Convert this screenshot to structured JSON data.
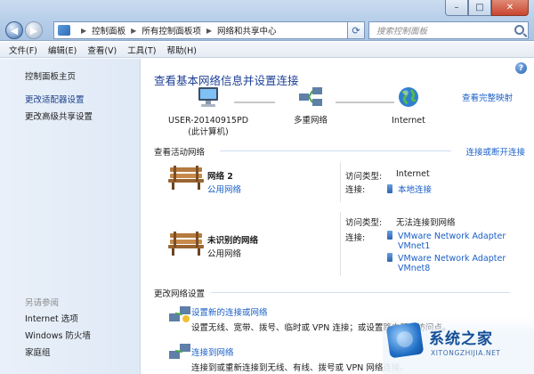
{
  "address": {
    "crumbs": [
      "控制面板",
      "所有控制面板项",
      "网络和共享中心"
    ],
    "search_placeholder": "搜索控制面板"
  },
  "menu": [
    "文件(F)",
    "编辑(E)",
    "查看(V)",
    "工具(T)",
    "帮助(H)"
  ],
  "sidebar": {
    "home": "控制面板主页",
    "links": [
      "更改适配器设置",
      "更改高级共享设置"
    ],
    "see_also_title": "另请参阅",
    "see_also": [
      "Internet 选项",
      "Windows 防火墙",
      "家庭组"
    ]
  },
  "main": {
    "heading": "查看基本网络信息并设置连接",
    "map_link": "查看完整映射",
    "nodes": [
      {
        "label": "USER-20140915PD",
        "sublabel": "(此计算机)"
      },
      {
        "label": "多重网络",
        "sublabel": ""
      },
      {
        "label": "Internet",
        "sublabel": ""
      }
    ],
    "active_title": "查看活动网络",
    "active_link": "连接或断开连接",
    "networks": [
      {
        "name": "网络  2",
        "category": "公用网络",
        "category_is_link": true,
        "access_label": "访问类型:",
        "access_value": "Internet",
        "conn_label": "连接:",
        "connections": [
          "本地连接"
        ]
      },
      {
        "name": "未识别的网络",
        "category": "公用网络",
        "category_is_link": false,
        "access_label": "访问类型:",
        "access_value": "无法连接到网络",
        "conn_label": "连接:",
        "connections": [
          "VMware Network Adapter",
          "VMnet1",
          "VMware Network Adapter",
          "VMnet8"
        ]
      }
    ],
    "change_title": "更改网络设置",
    "tasks": [
      {
        "title": "设置新的连接或网络",
        "desc": "设置无线、宽带、拨号、临时或 VPN 连接；或设置路由器或访问点。"
      },
      {
        "title": "连接到网络",
        "desc": "连接到或重新连接到无线、有线、拨号或 VPN 网络连接。"
      }
    ]
  },
  "watermark": {
    "title": "系统之家",
    "url": "XITONGZHIJIA.NET"
  }
}
